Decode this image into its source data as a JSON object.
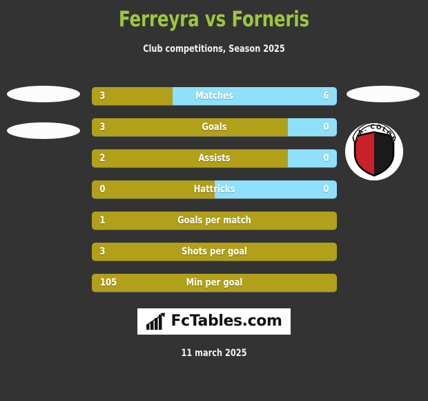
{
  "header": {
    "title": "Ferreyra vs Forneris",
    "subtitle": "Club competitions, Season 2025",
    "title_color": "#9dc63f",
    "subtitle_color": "#f2f2f2"
  },
  "theme": {
    "background": "#333333",
    "home_color": "#b1a018",
    "away_color": "#8fe1fa",
    "text_color": "#ffffff"
  },
  "chart_data": {
    "type": "bar",
    "title": "Ferreyra vs Forneris",
    "subtitle": "Club competitions, Season 2025",
    "orientation": "horizontal",
    "layout": "diverging-paired",
    "categories": [
      "Matches",
      "Goals",
      "Assists",
      "Hattricks",
      "Goals per match",
      "Shots per goal",
      "Min per goal"
    ],
    "series": [
      {
        "name": "Ferreyra",
        "color": "#b1a018",
        "values": [
          3,
          3,
          2,
          0,
          1,
          3,
          105
        ]
      },
      {
        "name": "Forneris",
        "color": "#8fe1fa",
        "values": [
          6,
          0,
          0,
          0,
          null,
          null,
          null
        ]
      }
    ],
    "rows": [
      {
        "label": "Matches",
        "left_value": "3",
        "right_value": "6",
        "left_pct": 33,
        "split": true
      },
      {
        "label": "Goals",
        "left_value": "3",
        "right_value": "0",
        "left_pct": 80,
        "split": true
      },
      {
        "label": "Assists",
        "left_value": "2",
        "right_value": "0",
        "left_pct": 80,
        "split": true
      },
      {
        "label": "Hattricks",
        "left_value": "0",
        "right_value": "0",
        "left_pct": 50,
        "split": true
      },
      {
        "label": "Goals per match",
        "left_value": "1",
        "right_value": "",
        "left_pct": 100,
        "split": false
      },
      {
        "label": "Shots per goal",
        "left_value": "3",
        "right_value": "",
        "left_pct": 100,
        "split": false
      },
      {
        "label": "Min per goal",
        "left_value": "105",
        "right_value": "",
        "left_pct": 100,
        "split": false
      }
    ]
  },
  "badge": {
    "club_name": "C.A. COLON",
    "shield_left_color": "#c9202a",
    "shield_right_color": "#1a1a1a",
    "banner_color": "#ffffff"
  },
  "logo": {
    "text": "FcTables.com",
    "icon": "bar-chart-icon"
  },
  "footer": {
    "date": "11 march 2025"
  }
}
